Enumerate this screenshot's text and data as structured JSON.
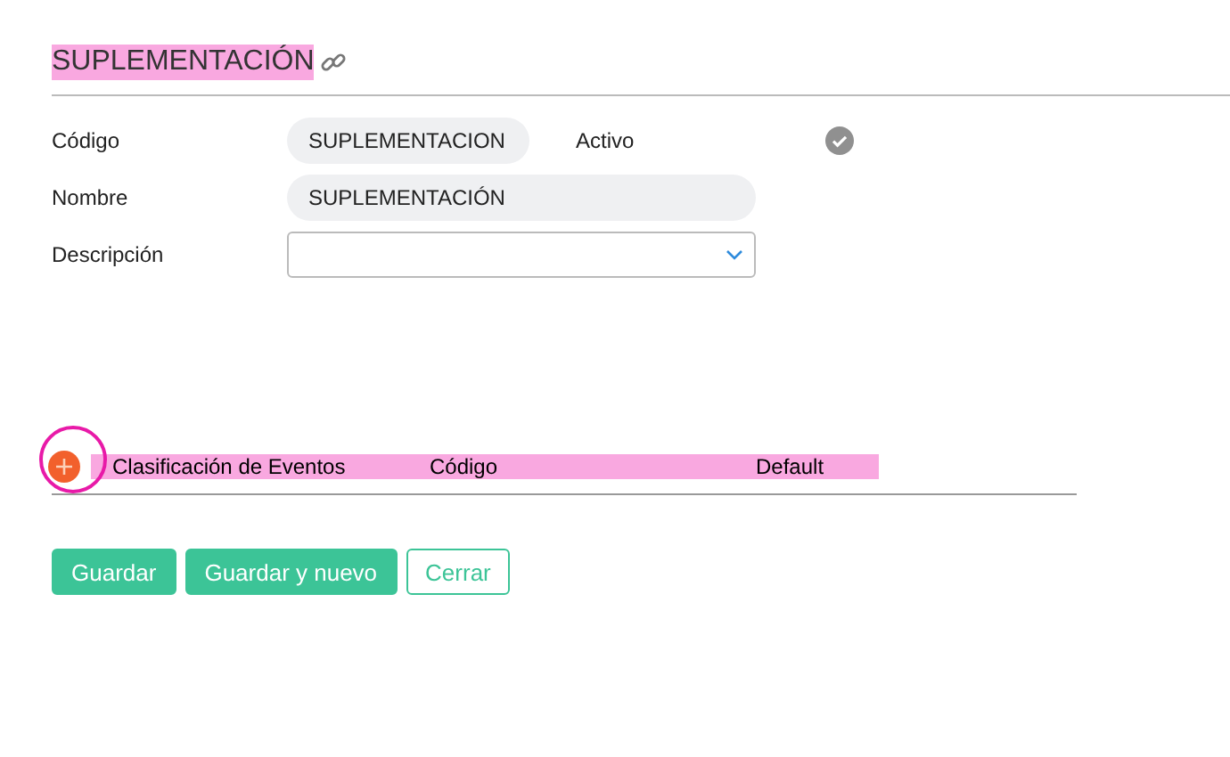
{
  "title": "SUPLEMENTACIÓN",
  "fields": [
    {
      "label": "Código",
      "value": "SUPLEMENTACION",
      "kind": "short"
    },
    {
      "label": "Nombre",
      "value": "SUPLEMENTACIÓN",
      "kind": "text"
    },
    {
      "label": "Descripción",
      "kind": "select"
    }
  ],
  "activo": {
    "label": "Activo",
    "checked": true
  },
  "table": {
    "columns": [
      "Clasificación de Eventos",
      "Código",
      "Default"
    ]
  },
  "buttons": [
    {
      "label": "Guardar",
      "kind": "primary"
    },
    {
      "label": "Guardar y nuevo",
      "kind": "primary"
    },
    {
      "label": "Cerrar",
      "kind": "outline"
    }
  ]
}
